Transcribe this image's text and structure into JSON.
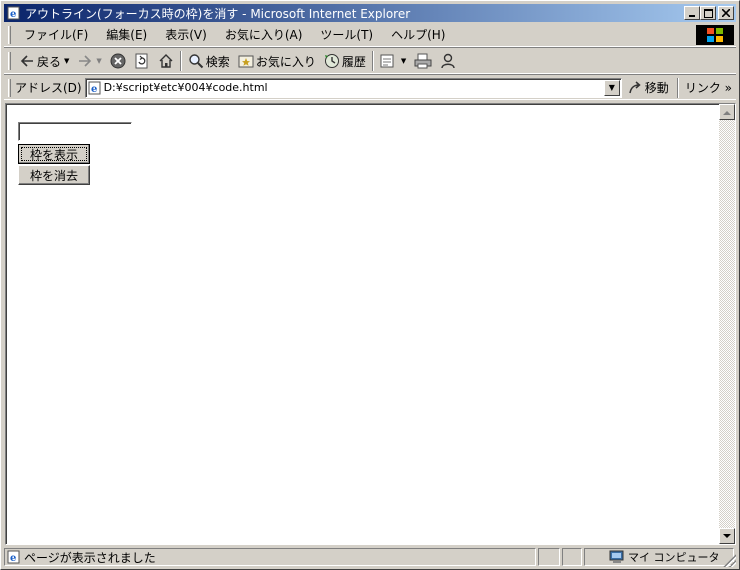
{
  "window": {
    "title": "アウトライン(フォーカス時の枠)を消す - Microsoft Internet Explorer"
  },
  "menu": [
    {
      "name": "file",
      "label": "ファイル(F)"
    },
    {
      "name": "edit",
      "label": "編集(E)"
    },
    {
      "name": "view",
      "label": "表示(V)"
    },
    {
      "name": "favorites",
      "label": "お気に入り(A)"
    },
    {
      "name": "tools",
      "label": "ツール(T)"
    },
    {
      "name": "help",
      "label": "ヘルプ(H)"
    }
  ],
  "toolbar": {
    "back_label": "戻る",
    "search_label": "検索",
    "favorites_label": "お気に入り",
    "history_label": "履歴"
  },
  "address": {
    "label": "アドレス(D)",
    "value": "D:¥script¥etc¥004¥code.html",
    "go_label": "移動",
    "links_label": "リンク"
  },
  "page": {
    "text_value": "",
    "show_button_label": "枠を表示",
    "hide_button_label": "枠を消去"
  },
  "status": {
    "text": "ページが表示されました",
    "zone": "マイ コンピュータ"
  }
}
